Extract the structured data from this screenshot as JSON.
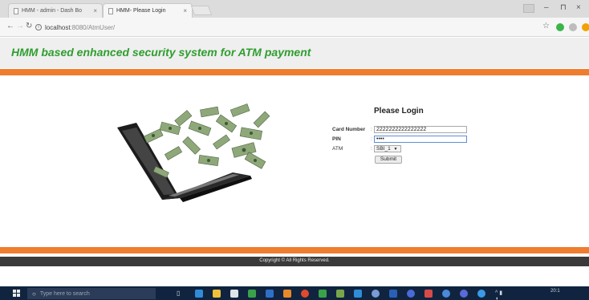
{
  "browser": {
    "tabs": [
      {
        "title": "HMM - admin - Dash Bo",
        "active": false
      },
      {
        "title": "HMM- Please Login",
        "active": true
      }
    ],
    "url": {
      "host": "localhost",
      "path": ":8080/AtmUser/"
    }
  },
  "page": {
    "site_title": "HMM based enhanced security system for ATM payment",
    "login": {
      "heading": "Please Login",
      "card_label": "Card Number",
      "card_value": "2222222222222222",
      "pin_label": "PIN",
      "pin_value": "••••",
      "atm_label": "ATM",
      "atm_selected": "SBI_1",
      "submit_label": "Submit"
    },
    "footer": "Copyright © All Rights Reserved."
  },
  "taskbar": {
    "search_placeholder": "Type here to search",
    "clock_time": "20:1"
  },
  "colors": {
    "title_green": "#2f9e2f",
    "accent_orange": "#ef7d2f",
    "footer_dark": "#3a3a3a",
    "taskbar_bg": "#10243f"
  }
}
